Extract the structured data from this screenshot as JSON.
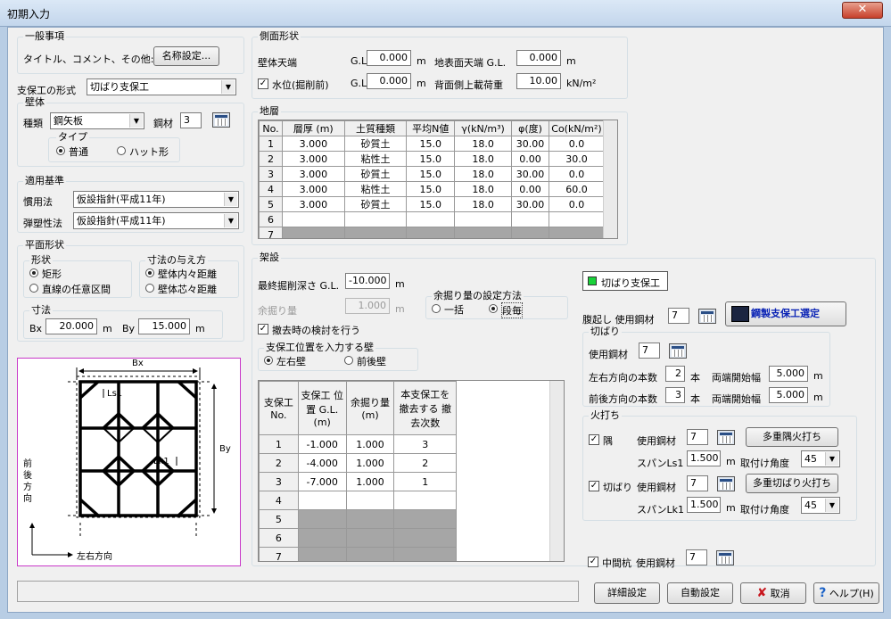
{
  "window": {
    "title": "初期入力",
    "close": "✕"
  },
  "general": {
    "group": "一般事項",
    "title_label": "タイトル、コメント、その他:",
    "name_btn": "名称設定..."
  },
  "support_type": {
    "label": "支保工の形式",
    "value": "切ばり支保工"
  },
  "wall": {
    "group": "壁体",
    "kind_label": "種類",
    "kind_value": "鋼矢板",
    "material_label": "鋼材",
    "material_value": "3",
    "type_group": "タイプ",
    "type_normal": "普通",
    "type_hat": "ハット形"
  },
  "standard": {
    "group": "適用基準",
    "method_label": "慣用法",
    "method_value": "仮設指針(平成11年)",
    "elastic_label": "弾塑性法",
    "elastic_value": "仮設指針(平成11年)"
  },
  "plan": {
    "group": "平面形状",
    "shape_group": "形状",
    "shape_rect": "矩形",
    "shape_any": "直線の任意区間",
    "dim_given_group": "寸法の与え方",
    "dim_inner": "壁体内々距離",
    "dim_center": "壁体芯々距離",
    "dim_group": "寸法",
    "bx_label": "Bx",
    "bx_value": "20.000",
    "by_label": "By",
    "by_value": "15.000",
    "unit": "m"
  },
  "diagram": {
    "bx": "Bx",
    "by": "By",
    "ls1": "Ls1",
    "lk1": "Lk1",
    "front": "前後方向",
    "lr": "左右方向"
  },
  "side": {
    "group": "側面形状",
    "wall_top": "壁体天端",
    "gl": "G.L.",
    "wall_top_value": "0.000",
    "unit_m": "m",
    "ground_top": "地表面天端 G.L.",
    "ground_value": "0.000",
    "water_label": "水位(掘削前)",
    "water_value": "0.000",
    "surcharge_label": "背面側上載荷重",
    "surcharge_value": "10.00",
    "surcharge_unit": "kN/m²",
    "water_checked": "✓"
  },
  "strata": {
    "group": "地層",
    "headers": [
      "No.",
      "層厚 (m)",
      "土質種類",
      "平均N値",
      "γ(kN/m³)",
      "φ(度)",
      "Co(kN/m²)"
    ],
    "rows": [
      [
        "1",
        "3.000",
        "砂質土",
        "15.0",
        "18.0",
        "30.00",
        "0.0"
      ],
      [
        "2",
        "3.000",
        "粘性土",
        "15.0",
        "18.0",
        "0.00",
        "30.0"
      ],
      [
        "3",
        "3.000",
        "砂質土",
        "15.0",
        "18.0",
        "30.00",
        "0.0"
      ],
      [
        "4",
        "3.000",
        "粘性土",
        "15.0",
        "18.0",
        "0.00",
        "60.0"
      ],
      [
        "5",
        "3.000",
        "砂質土",
        "15.0",
        "18.0",
        "30.00",
        "0.0"
      ],
      [
        "6",
        "",
        "",
        "",
        "",
        "",
        ""
      ],
      [
        "7",
        "",
        "",
        "",
        "",
        "",
        ""
      ]
    ]
  },
  "shoring": {
    "group": "架設",
    "final_depth_label": "最終掘削深さ G.L.",
    "final_depth_value": "-10.000",
    "unit": "m",
    "extra_label": "余掘り量",
    "extra_value": "1.000",
    "extra_method_group": "余掘り量の設定方法",
    "extra_all": "一括",
    "extra_each": "段毎",
    "removal_check": "撤去時の検討を行う",
    "check": "✓",
    "input_wall_group": "支保工位置を入力する壁",
    "wall_lr": "左右壁",
    "wall_fb": "前後壁",
    "table_headers": [
      "支保工 No.",
      "支保工 位置 G.L.(m)",
      "余掘り量 (m)",
      "本支保工を 撤去する 撤去次数"
    ],
    "rows": [
      [
        "1",
        "-1.000",
        "1.000",
        "3"
      ],
      [
        "2",
        "-4.000",
        "1.000",
        "2"
      ],
      [
        "3",
        "-7.000",
        "1.000",
        "1"
      ],
      [
        "4",
        "",
        "",
        ""
      ],
      [
        "5",
        "",
        "",
        ""
      ],
      [
        "6",
        "",
        "",
        ""
      ],
      [
        "7",
        "",
        "",
        ""
      ]
    ]
  },
  "strut": {
    "badge": "切ばり支保工",
    "waler_label": "腹起し 使用鋼材",
    "waler_value": "7",
    "steel_btn": "鋼製支保工選定",
    "strut_group": "切ばり",
    "use_steel": "使用鋼材",
    "strut_steel_value": "7",
    "lr_count_label": "左右方向の本数",
    "lr_count": "2",
    "count_unit": "本",
    "start_label": "両端開始幅",
    "lr_start": "5.000",
    "fb_count_label": "前後方向の本数",
    "fb_count": "3",
    "fb_start": "5.000",
    "unit": "m"
  },
  "fire": {
    "group": "火打ち",
    "corner": "隅",
    "use_steel": "使用鋼材",
    "corner_steel": "7",
    "multi_corner_btn": "多重隅火打ち",
    "span_ls1": "スパンLs1",
    "ls1_value": "1.500",
    "unit": "m",
    "angle_label": "取付け角度",
    "angle1": "45",
    "strut": "切ばり",
    "strut_steel": "7",
    "multi_strut_btn": "多重切ばり火打ち",
    "span_lk1": "スパンLk1",
    "lk1_value": "1.500",
    "angle2": "45",
    "check": "✓"
  },
  "mid_pile": {
    "label": "中間杭",
    "use_steel": "使用鋼材",
    "value": "7",
    "check": "✓"
  },
  "footer": {
    "detail": "詳細設定",
    "auto": "自動設定",
    "cancel": "取消",
    "help": "ヘルプ(H)"
  }
}
